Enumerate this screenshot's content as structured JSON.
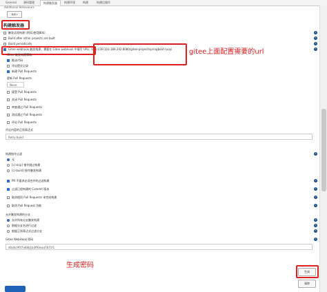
{
  "tabs": [
    {
      "label": "General"
    },
    {
      "label": "源码管理"
    },
    {
      "label": "构建触发器"
    },
    {
      "label": "构建环境"
    },
    {
      "label": "构建"
    },
    {
      "label": "构建后操作"
    }
  ],
  "additional_behaviours": "Additional Behaviours",
  "add_button": "新增 ▾",
  "trigger_heading": "构建触发器",
  "triggers": [
    {
      "label": "触发远程构建 (例如,使用脚本)",
      "checked": false
    },
    {
      "label": "Build after other projects are built",
      "checked": false
    },
    {
      "label": "Build periodically",
      "checked": false
    }
  ],
  "webhook_trigger": {
    "label": "Gitee webhook 触发构建，需要在 Gitee webhook 中填写 URL:",
    "url": "http://39.103.189.242:8080/gitee-project/springboot-ruoyi",
    "checked": true
  },
  "annotation_url": "gitee上面配置需要的url",
  "trigger_events_label": "Gitee 触发构建策略",
  "events": [
    {
      "label": "推送代码",
      "checked": true
    },
    {
      "label": "评论提交记录",
      "checked": false
    },
    {
      "label": "新建 Pull Requests",
      "checked": true
    }
  ],
  "pr_update_label": "更新 Pull Requests",
  "pr_select": "None",
  "pr_events": [
    {
      "label": "接受 Pull Requests",
      "checked": false
    },
    {
      "label": "关闭 Pull Requests",
      "checked": false
    },
    {
      "label": "审查通过 Pull Requests",
      "checked": false
    },
    {
      "label": "测试通过 Pull Requests",
      "checked": false
    },
    {
      "label": "评论 Pull Requests",
      "checked": false
    }
  ],
  "comment_regex_label": "评论内容的正则表达式",
  "comment_regex_value": "Retry build",
  "ci_skip_label": "构建指令过滤",
  "ci_skip_options": [
    {
      "label": "无",
      "checked": true
    },
    {
      "label": "[ci-skip] 指令跳过构建",
      "checked": false
    },
    {
      "label": "[ci-build] 指令触发构建",
      "checked": false
    }
  ],
  "options": [
    {
      "label": "PR 不要求必须合并的过滤构建",
      "checked": true
    },
    {
      "label": "过滤已经构建的 Commit 版本",
      "checked": true
    },
    {
      "label": "取消相同 Pull Requests 未完成构建",
      "checked": false
    },
    {
      "label": "取消 Pull Request 功能",
      "checked": false
    }
  ],
  "branch_filter_label": "允许触发构建的分支",
  "branch_options": [
    {
      "label": "允许所有分支触发构建",
      "checked": true
    },
    {
      "label": "根据分支名进行过滤",
      "checked": false
    },
    {
      "label": "根据正则表达式过滤分支",
      "checked": false
    }
  ],
  "password_label": "Gitee WebHook 密码",
  "password_value": "d0a6c9f37a68b1b3f93ead7871f1",
  "generate_button": "生成",
  "annotation_password": "生成密码",
  "apply_button": "清除",
  "accent_color": "#1f63b8",
  "highlight_color": "#e02020"
}
